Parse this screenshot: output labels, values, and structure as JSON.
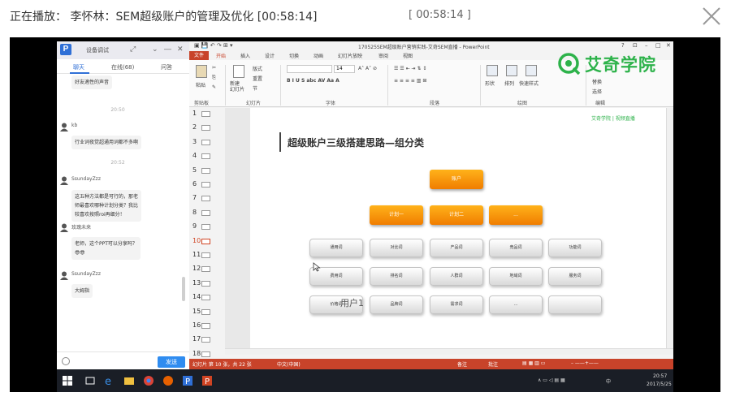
{
  "header": {
    "now_playing": "正在播放： 李怀林：SEM超级账户的管理及优化 [00:58:14]",
    "center_time": "[ 00:58:14 ]"
  },
  "chat": {
    "title": "设备调试",
    "tabs": [
      "聊天",
      "在线(68)",
      "问答"
    ],
    "active_tab": 0,
    "messages": [
      {
        "kind": "bubble",
        "text": "好友適性的声音"
      },
      {
        "kind": "time",
        "text": "20:50"
      },
      {
        "kind": "name",
        "text": "kb"
      },
      {
        "kind": "bubble",
        "text": "行业词夜觉超通用词都不多啊"
      },
      {
        "kind": "time",
        "text": "20:52"
      },
      {
        "kind": "name",
        "text": "SsundayZzz"
      },
      {
        "kind": "bubble",
        "text": "这五种方法都是可行的，那老\n师最喜欢哪种计划分类？我比\n较喜欢按照roi再细分！"
      },
      {
        "kind": "name",
        "text": "玫瑰未来"
      },
      {
        "kind": "bubble",
        "text": "老师，这个PPT可以分享吗？\n😎😎"
      },
      {
        "kind": "name",
        "text": "SsundayZzz"
      },
      {
        "kind": "bubble",
        "text": "大姆指"
      }
    ],
    "send_label": "发送"
  },
  "ppt": {
    "doc_title": "170525SEM超级账户营销实践-艾奇SEM直播 - PowerPoint",
    "ribbon_tabs": [
      "文件",
      "开始",
      "插入",
      "设计",
      "切换",
      "动画",
      "幻灯片放映",
      "审阅",
      "视图"
    ],
    "groups": [
      "剪贴板",
      "幻灯片",
      "字体",
      "段落",
      "绘图",
      "编辑"
    ],
    "buttons": {
      "paste": "粘贴",
      "new_slide": "新建\n幻灯片",
      "layout": "版式",
      "reset": "重置",
      "section": "节",
      "font_size": "14",
      "shapes": "形状",
      "arrange": "排列",
      "quick_styles": "快速样式",
      "find": "查找",
      "replace": "替换",
      "select": "选择"
    },
    "brand": "艾奇学院",
    "slide_numbers": [
      "1",
      "2",
      "3",
      "4",
      "5",
      "6",
      "7",
      "8",
      "9",
      "10",
      "11",
      "12",
      "13",
      "14",
      "15",
      "16",
      "17",
      "18"
    ],
    "selected_slide": 10,
    "slide": {
      "title": "超级账户三级搭建思路—组分类",
      "logos": "艾奇学院 | 视频直播",
      "root": "账户",
      "plans": [
        "计划一",
        "计划二",
        "..."
      ],
      "groups_row1": [
        "通用词",
        "对比词",
        "产品词",
        "竞品词",
        "功能词"
      ],
      "groups_row2": [
        "费用词",
        "排名词",
        "人群词",
        "地域词",
        "服务词"
      ],
      "groups_row3": [
        "价格词",
        "品牌词",
        "需求词",
        "..."
      ],
      "overlay": "用户1"
    },
    "status": {
      "slide_info": "幻灯片 第 10 张，共 22 张",
      "language": "中文(中国)",
      "notes": "备注",
      "comments": "批注"
    }
  },
  "taskbar": {
    "time": "20:57",
    "date": "2017/5/25",
    "ime": "中"
  }
}
